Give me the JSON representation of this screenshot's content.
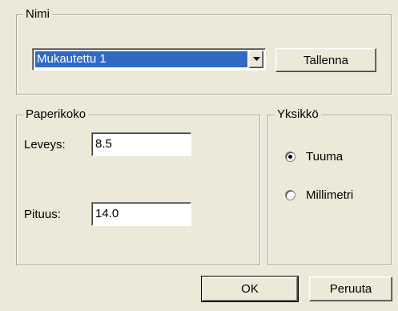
{
  "name_group": {
    "title": "Nimi",
    "selected": "Mukautettu 1",
    "save_label": "Tallenna"
  },
  "paper_group": {
    "title": "Paperikoko",
    "width_label": "Leveys:",
    "width_value": "8.5",
    "height_label": "Pituus:",
    "height_value": "14.0"
  },
  "unit_group": {
    "title": "Yksikkö",
    "options": [
      {
        "label": "Tuuma",
        "selected": true
      },
      {
        "label": "Millimetri",
        "selected": false
      }
    ]
  },
  "footer": {
    "ok_label": "OK",
    "cancel_label": "Peruuta"
  }
}
